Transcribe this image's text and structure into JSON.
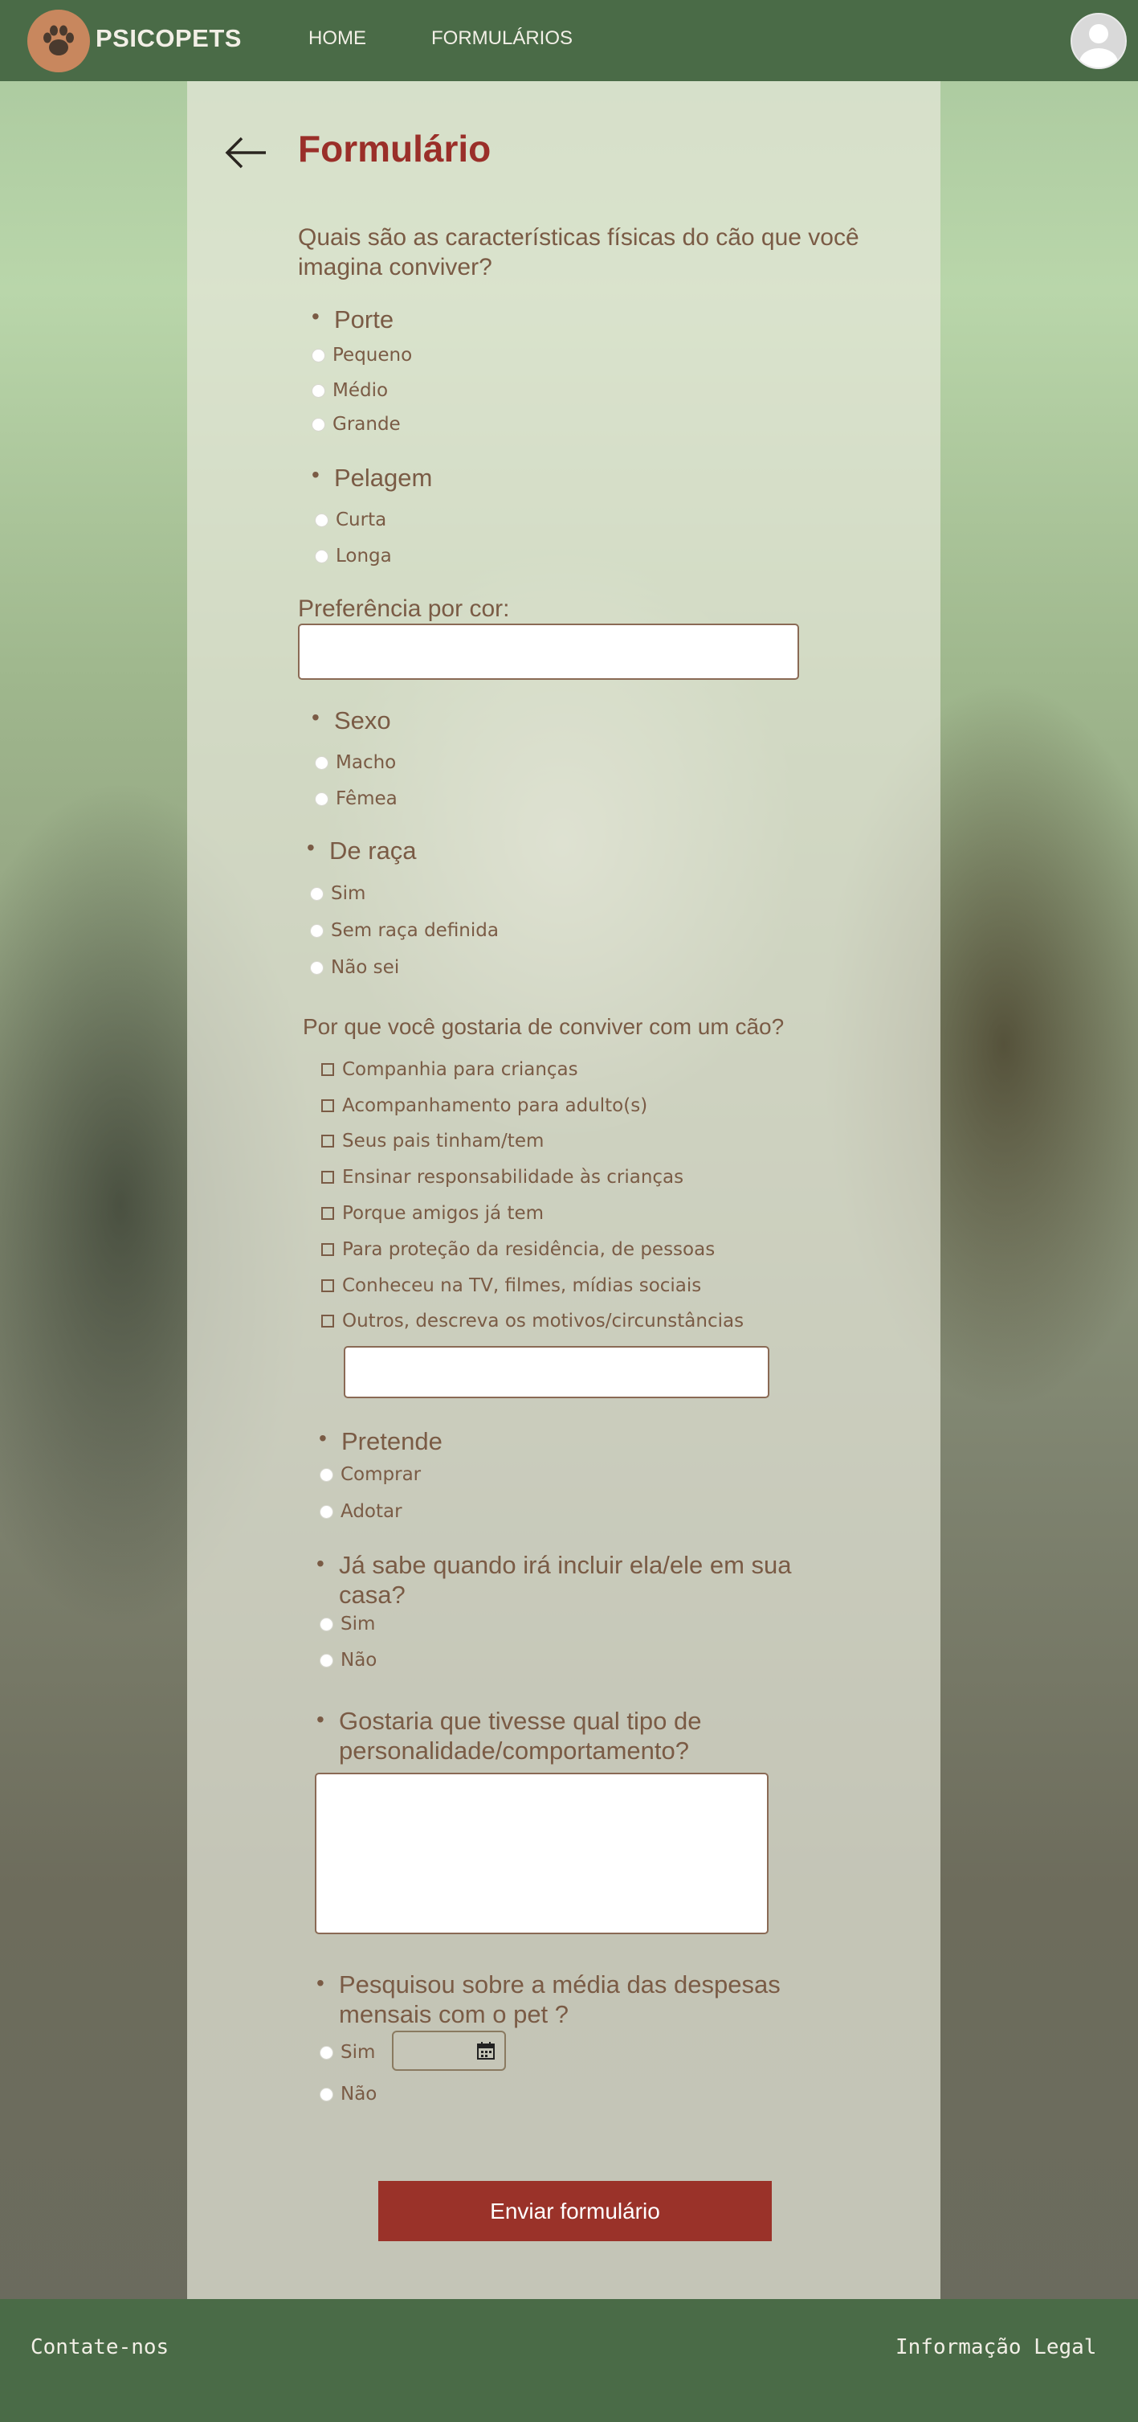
{
  "header": {
    "brand": "PSICOPETS",
    "nav": [
      "HOME",
      "FORMULÁRIOS"
    ],
    "logo_icon": "paw-icon",
    "avatar_icon": "user-avatar-icon"
  },
  "form": {
    "title": "Formulário",
    "q1": "Quais são as características físicas do cão que você imagina conviver?",
    "porte": {
      "label": "Porte",
      "options": [
        "Pequeno",
        "Médio",
        "Grande"
      ]
    },
    "pelagem": {
      "label": "Pelagem",
      "options": [
        "Curta",
        "Longa"
      ]
    },
    "cor_label": "Preferência por cor:",
    "sexo": {
      "label": "Sexo",
      "options": [
        "Macho",
        "Fêmea"
      ]
    },
    "raca": {
      "label": "De raça",
      "options": [
        "Sim",
        "Sem raça definida",
        "Não sei"
      ]
    },
    "q2": "Por que você gostaria de conviver com um cão?",
    "motivos": [
      "Companhia para crianças",
      "Acompanhamento para adulto(s)",
      "Seus pais tinham/tem",
      "Ensinar responsabilidade às crianças",
      "Porque amigos já tem",
      "Para proteção da residência, de pessoas",
      "Conheceu na TV, filmes, mídias sociais",
      "Outros, descreva os motivos/circunstâncias"
    ],
    "pretende": {
      "label": "Pretende",
      "options": [
        "Comprar",
        "Adotar"
      ]
    },
    "quando": {
      "label": "Já sabe quando irá incluir ela/ele em sua casa?",
      "options": [
        "Sim",
        "Não"
      ]
    },
    "personalidade_label": "Gostaria que tivesse qual tipo de personalidade/comportamento?",
    "despesas": {
      "label": "Pesquisou sobre a média das despesas mensais com o pet ?",
      "options": [
        "Sim",
        "Não"
      ]
    },
    "submit": "Enviar formulário"
  },
  "footer": {
    "contact": "Contate-nos",
    "legal": "Informação Legal"
  },
  "colors": {
    "header": "#4a6b47",
    "accent": "#9a2f29",
    "text": "#7a5b45"
  }
}
